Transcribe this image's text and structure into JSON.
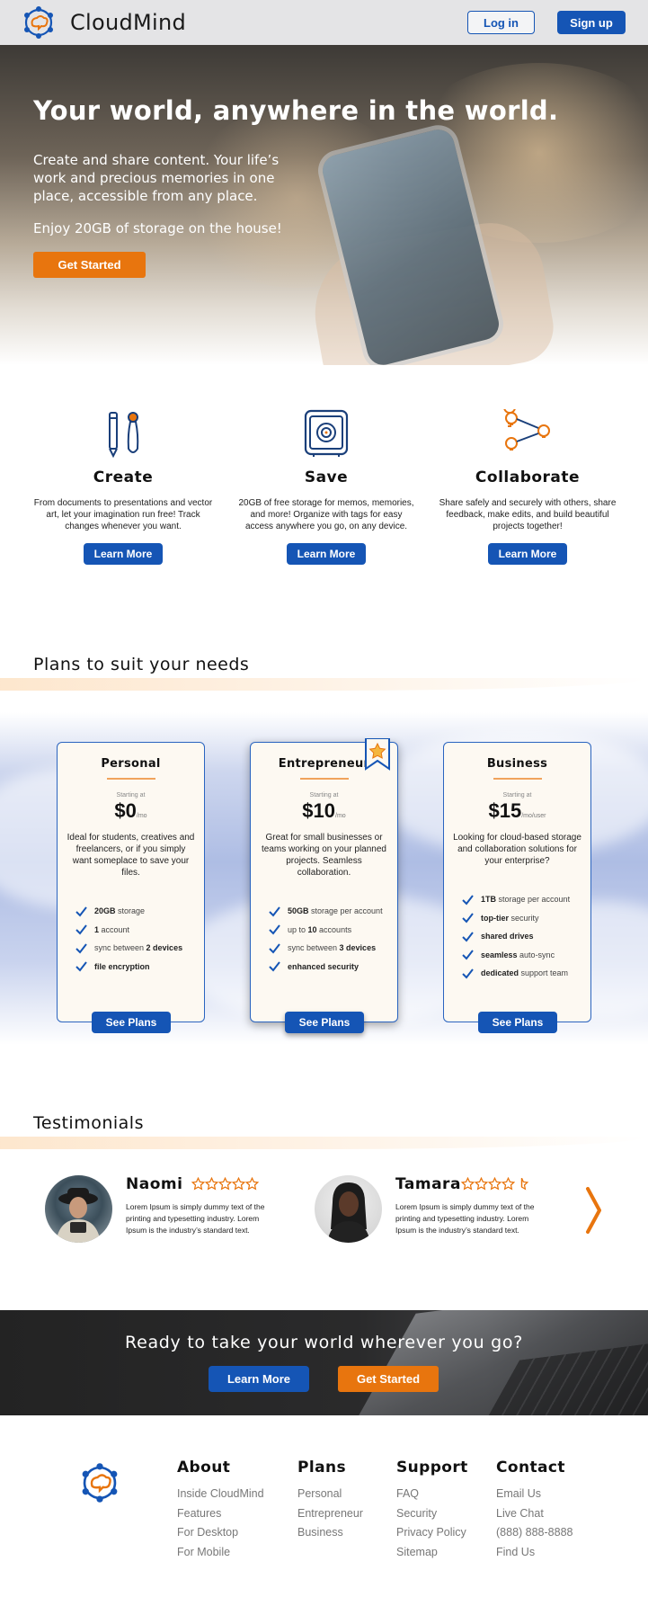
{
  "header": {
    "brand": "CloudMind",
    "login_label": "Log in",
    "signup_label": "Sign up"
  },
  "hero": {
    "title": "Your world, anywhere in the world.",
    "subtitle": "Create and share content. Your life’s work and precious memories in one place, accessible from any place.",
    "offer": "Enjoy 20GB of storage on the house!",
    "cta_label": "Get Started"
  },
  "features": [
    {
      "icon": "brush-pencil-icon",
      "title": "Create",
      "text": "From documents to presentations and vector art, let your imagination run free! Track changes whenever you want.",
      "button": "Learn More"
    },
    {
      "icon": "safe-icon",
      "title": "Save",
      "text": "20GB of free storage for memos, memories, and more! Organize with tags for easy access anywhere you go, on any device.",
      "button": "Learn More"
    },
    {
      "icon": "share-nodes-icon",
      "title": "Collaborate",
      "text": "Share safely and securely with others, share feedback, make edits, and build beautiful projects together!",
      "button": "Learn More"
    }
  ],
  "plans_title": "Plans to suit your needs",
  "plans": [
    {
      "name": "Personal",
      "starting": "Starting at",
      "price": "$0",
      "unit": "/mo",
      "desc": "Ideal for students, creatives and freelancers, or if you simply want someplace to save your files.",
      "features": [
        {
          "bold": "20GB",
          "rest": " storage"
        },
        {
          "bold": "1",
          "rest": " account"
        },
        {
          "pre": "sync between ",
          "bold": "2 devices"
        },
        {
          "bold": "file encryption",
          "rest": ""
        }
      ],
      "button": "See Plans"
    },
    {
      "name": "Entrepreneur",
      "starting": "Starting at",
      "price": "$10",
      "unit": "/mo",
      "desc": "Great for small businesses or teams working on your planned projects. Seamless collaboration.",
      "features": [
        {
          "bold": "50GB",
          "rest": " storage per account"
        },
        {
          "pre": "up to ",
          "bold": "10",
          "rest": " accounts"
        },
        {
          "pre": "sync between ",
          "bold": "3 devices"
        },
        {
          "bold": "enhanced security",
          "rest": ""
        }
      ],
      "button": "See Plans"
    },
    {
      "name": "Business",
      "starting": "Starting at",
      "price": "$15",
      "unit": "/mo/user",
      "desc": "Looking for cloud-based storage and collaboration solutions for your enterprise?",
      "features": [
        {
          "bold": "1TB",
          "rest": " storage per account"
        },
        {
          "bold": "top-tier",
          "rest": " security"
        },
        {
          "bold": "shared drives",
          "rest": ""
        },
        {
          "bold": "seamless",
          "rest": " auto-sync"
        },
        {
          "bold": "dedicated",
          "rest": " support team"
        }
      ],
      "button": "See Plans"
    }
  ],
  "testimonials_title": "Testimonials",
  "testimonials": [
    {
      "name": "Naomi",
      "rating": 5,
      "text": "Lorem Ipsum is simply dummy text of the printing and typesetting industry. Lorem Ipsum is the industry’s standard text."
    },
    {
      "name": "Tamara",
      "rating": 4.5,
      "text": "Lorem Ipsum is simply dummy text of the printing and typesetting industry. Lorem Ipsum is the industry’s standard text."
    }
  ],
  "cta": {
    "title": "Ready to take your world wherever you go?",
    "learn_more": "Learn More",
    "get_started": "Get Started"
  },
  "footer": {
    "columns": [
      {
        "title": "About",
        "links": [
          "Inside CloudMind",
          "Features",
          "For Desktop",
          "For Mobile"
        ]
      },
      {
        "title": "Plans",
        "links": [
          "Personal",
          "Entrepreneur",
          "Business"
        ]
      },
      {
        "title": "Support",
        "links": [
          "FAQ",
          "Security",
          "Privacy Policy",
          "Sitemap"
        ]
      },
      {
        "title": "Contact",
        "links": [
          "Email Us",
          "Live Chat",
          "(888) 888-8888",
          "Find Us"
        ]
      }
    ]
  },
  "colors": {
    "primary": "#1555b5",
    "accent": "#e8750e",
    "card_bg": "#fdf9f2"
  }
}
